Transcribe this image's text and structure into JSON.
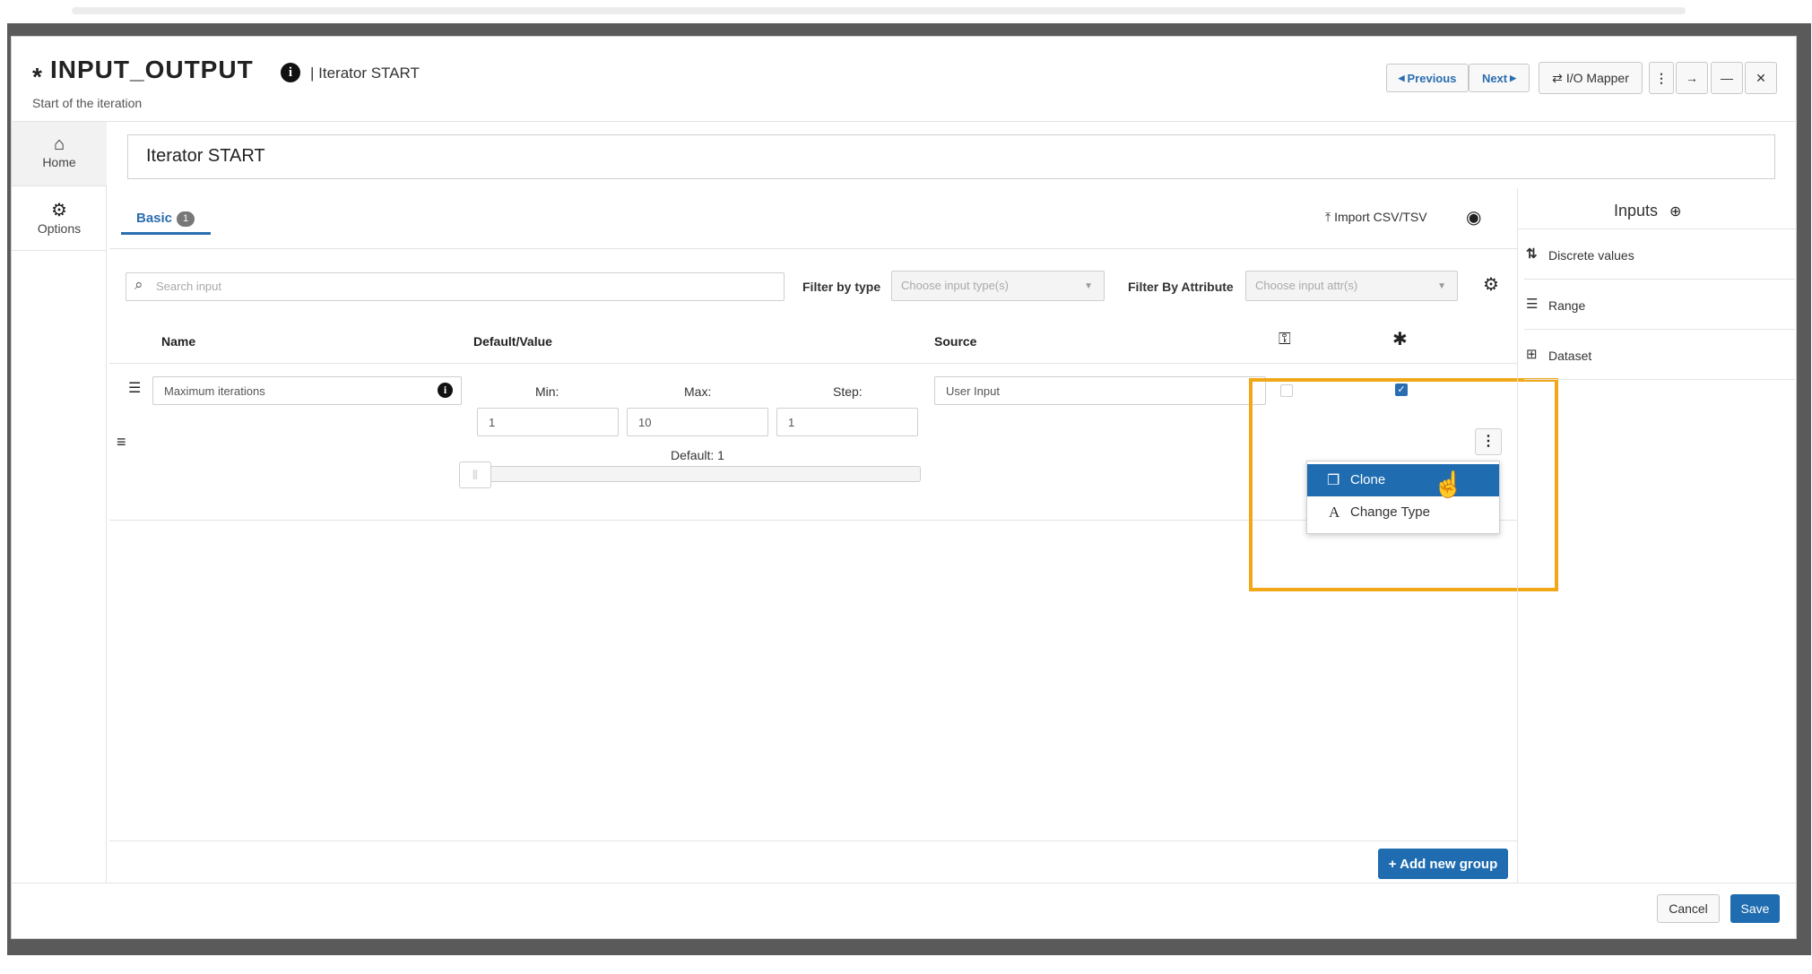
{
  "header": {
    "modified_marker": "*",
    "title": "INPUT_OUTPUT",
    "subtitle": "| Iterator START",
    "description": "Start of the iteration",
    "previous_label": "Previous",
    "next_label": "Next",
    "io_mapper_label": "I/O Mapper"
  },
  "sidebar": {
    "items": [
      {
        "label": "Home",
        "icon": "home-icon"
      },
      {
        "label": "Options",
        "icon": "gear-icon"
      }
    ]
  },
  "name_field": {
    "value": "Iterator START"
  },
  "tabs": {
    "basic_label": "Basic",
    "basic_count": "1",
    "import_label": "Import CSV/TSV"
  },
  "filters": {
    "search_placeholder": "Search input",
    "filter_type_label": "Filter by type",
    "filter_type_placeholder": "Choose input type(s)",
    "filter_attr_label": "Filter By Attribute",
    "filter_attr_placeholder": "Choose input attr(s)"
  },
  "table": {
    "columns": [
      "Name",
      "Default/Value",
      "Source"
    ],
    "row": {
      "name": "Maximum iterations",
      "min_label": "Min:",
      "max_label": "Max:",
      "step_label": "Step:",
      "min_value": "1",
      "max_value": "10",
      "step_value": "1",
      "default_label": "Default: 1",
      "source": "User Input",
      "key_checked": false,
      "required_checked": true
    }
  },
  "context_menu": {
    "items": [
      "Clone",
      "Change Type"
    ],
    "highlighted": "Clone"
  },
  "right_panel": {
    "title": "Inputs",
    "items": [
      "Discrete values",
      "Range",
      "Dataset"
    ]
  },
  "actions": {
    "add_group_label": "+ Add new group",
    "cancel_label": "Cancel",
    "save_label": "Save"
  },
  "colors": {
    "accent": "#1f6cb0",
    "highlight_frame": "#f0a818"
  }
}
